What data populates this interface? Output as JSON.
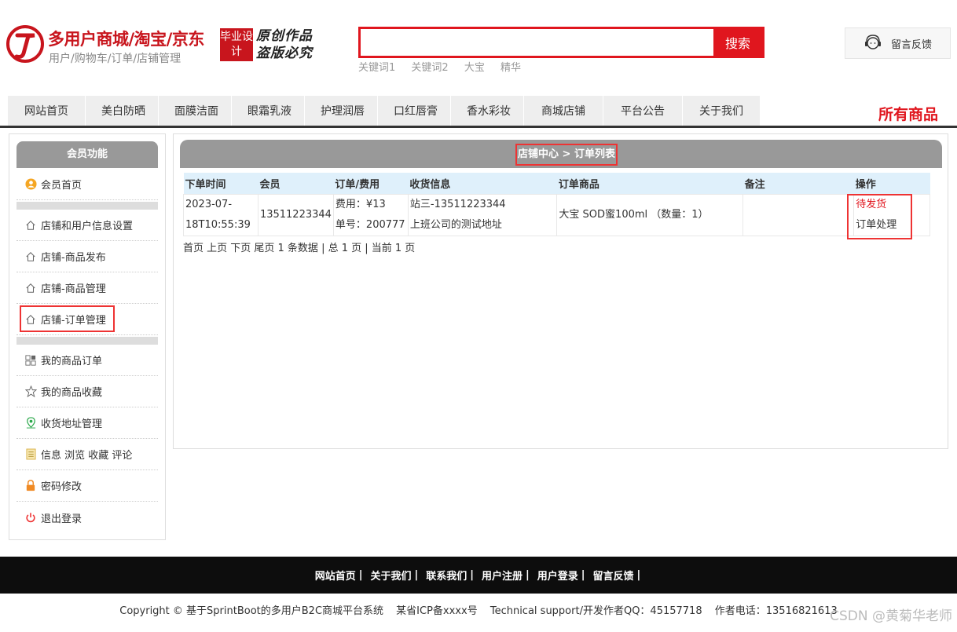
{
  "header": {
    "brand_title": "多用户商城/淘宝/京东",
    "brand_subtitle": "用户/购物车/订单/店铺管理",
    "badge_text": "毕业设计",
    "calligraphy_line1": "原创作品",
    "calligraphy_line2": "盗版必究",
    "search_value": "",
    "search_button": "搜索",
    "keywords": [
      "关键词1",
      "关键词2",
      "大宝",
      "精华"
    ],
    "feedback_label": "留言反馈"
  },
  "nav": {
    "items": [
      "网站首页",
      "美白防晒",
      "面膜洁面",
      "眼霜乳液",
      "护理润唇",
      "口红唇膏",
      "香水彩妆",
      "商城店铺",
      "平台公告",
      "关于我们"
    ],
    "all_goods": "所有商品"
  },
  "sidebar": {
    "title": "会员功能",
    "home": "会员首页",
    "shop_items": [
      "店铺和用户信息设置",
      "店铺-商品发布",
      "店铺-商品管理",
      "店铺-订单管理"
    ],
    "user_items": [
      "我的商品订单",
      "我的商品收藏",
      "收货地址管理",
      "信息 浏览 收藏 评论",
      "密码修改",
      "退出登录"
    ]
  },
  "main": {
    "breadcrumb": "店铺中心 > 订单列表",
    "columns": [
      "下单时间",
      "会员",
      "订单/费用",
      "收货信息",
      "订单商品",
      "备注",
      "操作"
    ],
    "order": {
      "time_line1": "2023-07-",
      "time_line2": "18T10:55:39",
      "member": "13511223344",
      "fee": "费用：¥13",
      "order_no": "单号：200777",
      "receiver": "站三-13511223344",
      "address": "上班公司的测试地址",
      "product": "大宝 SOD蜜100ml （数量：1）",
      "remark": "",
      "status": "待发货",
      "action": "订单处理"
    },
    "pager": "首页 上页 下页 尾页 1 条数据 | 总 1 页 | 当前 1 页"
  },
  "footer": {
    "links": [
      "网站首页",
      "关于我们",
      "联系我们",
      "用户注册",
      "用户登录",
      "留言反馈"
    ],
    "copyright": "Copyright © 基于SprintBoot的多用户B2C商城平台系统",
    "icp": "某省ICP备xxxx号",
    "support": "Technical support/开发作者QQ：45157718",
    "phone": "作者电话：13516821613",
    "watermark": "CSDN @黄菊华老师"
  },
  "colors": {
    "brand_red": "#e0161e",
    "header_gray": "#999999",
    "table_head": "#dff0fb",
    "footer_bg": "#0d0d0d"
  }
}
